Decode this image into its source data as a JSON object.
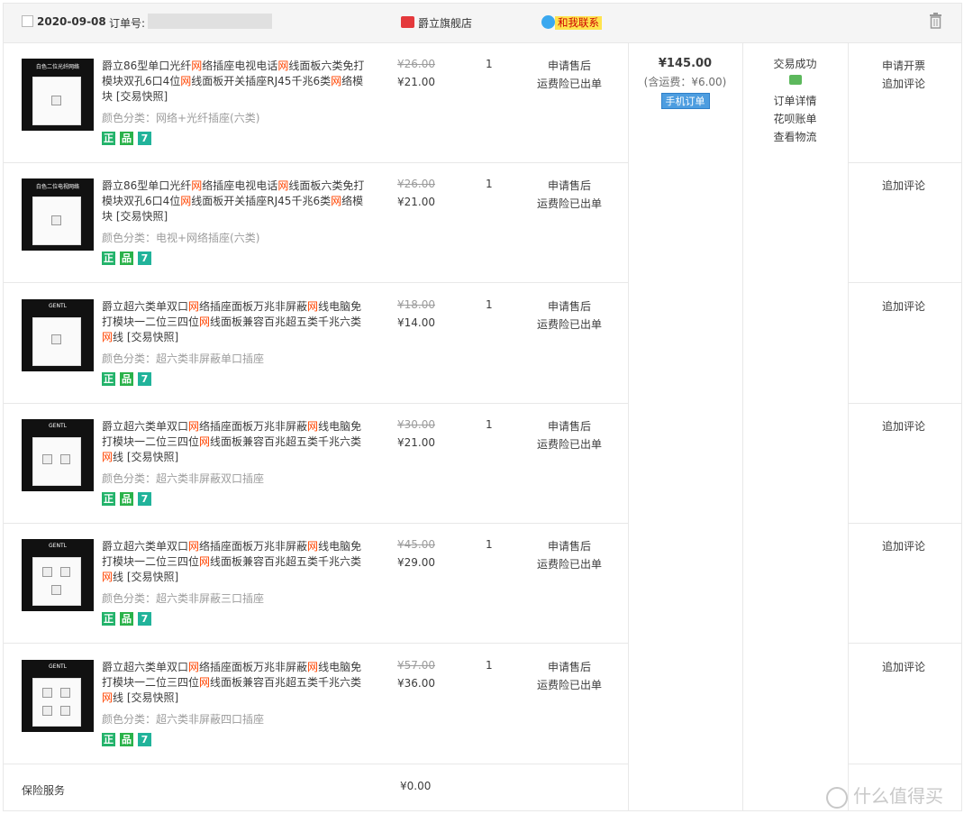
{
  "header": {
    "date": "2020-09-08",
    "order_label": "订单号:",
    "shop_name": "爵立旗舰店",
    "contact_label": "和我联系"
  },
  "items": [
    {
      "thumb_caption": "白色二位光纤网络",
      "title_parts": [
        "爵立86型单口光纤",
        "网",
        "络插座电视电话",
        "网",
        "线面板六类免打模块双孔6口4位",
        "网",
        "线面板开关插座RJ45千兆6类",
        "网",
        "络模块 [交易快照]"
      ],
      "variant": "颜色分类：网络+光纤插座(六类)",
      "price_orig": "¥26.00",
      "price_now": "¥21.00",
      "qty": "1",
      "service1": "申请售后",
      "service2": "运费险已出单",
      "actions": [
        "申请开票",
        "追加评论"
      ]
    },
    {
      "thumb_caption": "白色二位电视网络",
      "title_parts": [
        "爵立86型单口光纤",
        "网",
        "络插座电视电话",
        "网",
        "线面板六类免打模块双孔6口4位",
        "网",
        "线面板开关插座RJ45千兆6类",
        "网",
        "络模块 [交易快照]"
      ],
      "variant": "颜色分类：电视+网络插座(六类)",
      "price_orig": "¥26.00",
      "price_now": "¥21.00",
      "qty": "1",
      "service1": "申请售后",
      "service2": "运费险已出单",
      "actions": [
        "追加评论"
      ]
    },
    {
      "thumb_caption": "GENTL",
      "title_parts": [
        "爵立超六类单双口",
        "网",
        "络插座面板万兆非屏蔽",
        "网",
        "线电脑免打模块一二位三四位",
        "网",
        "线面板兼容百兆超五类千兆六类",
        "网",
        "线 [交易快照]"
      ],
      "variant": "颜色分类：超六类非屏蔽单口插座",
      "price_orig": "¥18.00",
      "price_now": "¥14.00",
      "qty": "1",
      "service1": "申请售后",
      "service2": "运费险已出单",
      "actions": [
        "追加评论"
      ]
    },
    {
      "thumb_caption": "GENTL",
      "title_parts": [
        "爵立超六类单双口",
        "网",
        "络插座面板万兆非屏蔽",
        "网",
        "线电脑免打模块一二位三四位",
        "网",
        "线面板兼容百兆超五类千兆六类",
        "网",
        "线 [交易快照]"
      ],
      "variant": "颜色分类：超六类非屏蔽双口插座",
      "price_orig": "¥30.00",
      "price_now": "¥21.00",
      "qty": "1",
      "service1": "申请售后",
      "service2": "运费险已出单",
      "actions": [
        "追加评论"
      ]
    },
    {
      "thumb_caption": "GENTL",
      "title_parts": [
        "爵立超六类单双口",
        "网",
        "络插座面板万兆非屏蔽",
        "网",
        "线电脑免打模块一二位三四位",
        "网",
        "线面板兼容百兆超五类千兆六类",
        "网",
        "线 [交易快照]"
      ],
      "variant": "颜色分类：超六类非屏蔽三口插座",
      "price_orig": "¥45.00",
      "price_now": "¥29.00",
      "qty": "1",
      "service1": "申请售后",
      "service2": "运费险已出单",
      "actions": [
        "追加评论"
      ]
    },
    {
      "thumb_caption": "GENTL",
      "title_parts": [
        "爵立超六类单双口",
        "网",
        "络插座面板万兆非屏蔽",
        "网",
        "线电脑免打模块一二位三四位",
        "网",
        "线面板兼容百兆超五类千兆六类",
        "网",
        "线 [交易快照]"
      ],
      "variant": "颜色分类：超六类非屏蔽四口插座",
      "price_orig": "¥57.00",
      "price_now": "¥36.00",
      "qty": "1",
      "service1": "申请售后",
      "service2": "运费险已出单",
      "actions": [
        "追加评论"
      ]
    }
  ],
  "badges": [
    "正",
    "品",
    "7"
  ],
  "summary": {
    "total": "¥145.00",
    "shipping": "(含运费：¥6.00)",
    "mobile_tag": "手机订单",
    "status": "交易成功",
    "links": [
      "订单详情",
      "花呗账单",
      "查看物流"
    ]
  },
  "insurance": {
    "label": "保险服务",
    "price": "¥0.00"
  },
  "watermark": "什么值得买",
  "colors": {
    "highlight": "#ff4400",
    "header_bg": "#f5f5f5",
    "border": "#e8e8e8"
  }
}
